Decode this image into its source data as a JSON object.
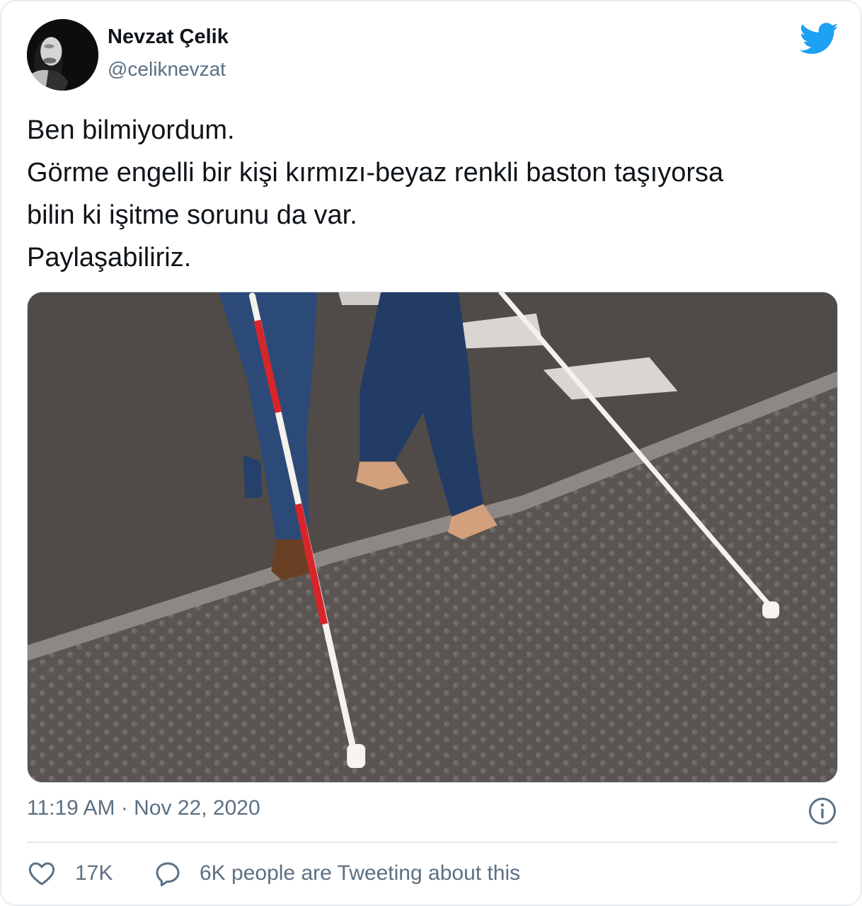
{
  "author": {
    "name": "Nevzat Çelik",
    "handle": "@celiknevzat"
  },
  "logo_icon": "twitter-bird-icon",
  "tweet": {
    "lines": [
      "Ben bilmiyordum.",
      "Görme engelli bir kişi kırmızı-beyaz renkli baston taşıyorsa",
      "bilin ki işitme sorunu da var.",
      "Paylaşabiliriz."
    ]
  },
  "timestamp": "11:19 AM · Nov 22, 2020",
  "actions": {
    "like_count": "17K",
    "reply_text": "6K people are Tweeting about this"
  },
  "colors": {
    "twitter_blue": "#1da1f2",
    "secondary_text": "#5b7083",
    "primary_text": "#0f1419",
    "border": "#e6ecf0"
  }
}
